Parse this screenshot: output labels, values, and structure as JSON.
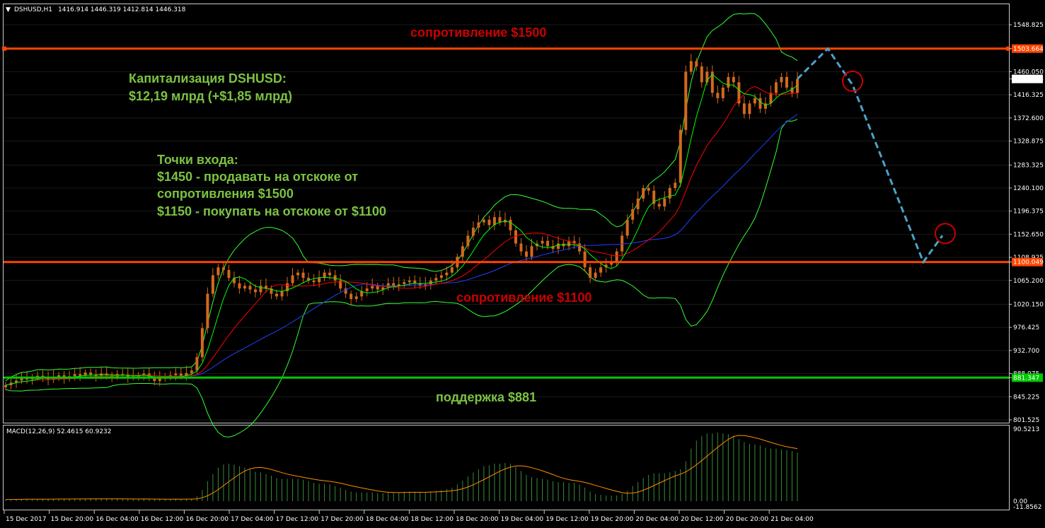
{
  "header": {
    "symbol": "DSHUSD,H1",
    "ohlc": "1416.914 1446.319 1412.814 1446.318"
  },
  "macd": {
    "label": "MACD(12,26,9) 52.4615 60.9232",
    "axis": [
      "90.5213",
      "0.00",
      "-11.8562"
    ]
  },
  "price_axis": [
    "1548.825",
    "1503.664",
    "1460.050",
    "1446.318",
    "1416.325",
    "1372.600",
    "1328.875",
    "1283.325",
    "1240.100",
    "1196.375",
    "1152.650",
    "1108.925",
    "1100.049",
    "1065.200",
    "1020.150",
    "976.425",
    "932.700",
    "888.975",
    "881.347",
    "845.225",
    "801.525"
  ],
  "time_axis": [
    "15 Dec 2017",
    "15 Dec 20:00",
    "16 Dec 04:00",
    "16 Dec 12:00",
    "16 Dec 20:00",
    "17 Dec 04:00",
    "17 Dec 12:00",
    "17 Dec 20:00",
    "18 Dec 04:00",
    "18 Dec 12:00",
    "18 Dec 20:00",
    "19 Dec 04:00",
    "19 Dec 12:00",
    "19 Dec 20:00",
    "20 Dec 04:00",
    "20 Dec 12:00",
    "20 Dec 20:00",
    "21 Dec 04:00"
  ],
  "annotations": {
    "resistance_top": "сопротивление $1500",
    "resistance_low": "сопротивление $1100",
    "support": "поддержка $881",
    "cap_line1": "Капитализация DSHUSD:",
    "cap_line2": "$12,19 млрд (+$1,85 млрд)",
    "entry_title": "Точки входа:",
    "entry_1": "$1450 - продавать на отскоке от",
    "entry_2": "сопротивления $1500",
    "entry_3": "$1150 - покупать на отскоке от $1100"
  },
  "colors": {
    "resistance": "#ff4500",
    "support": "#00c800",
    "candle": "#d2691e",
    "ma_fast": "#00ff00",
    "ma_mid": "#ff0000",
    "ma_slow": "#2040ff",
    "bollinger": "#33ff33",
    "forecast": "#4aa3c8",
    "ann_red": "#cc0000",
    "ann_green": "#7cc242"
  },
  "chart_data": {
    "type": "candlestick",
    "price_levels": {
      "resistance_top": 1503.664,
      "resistance_low": 1100.049,
      "support": 881.347,
      "current": 1446.318
    },
    "price_range": [
      801.525,
      1570
    ],
    "macd_range": [
      -11.8562,
      100
    ],
    "close_series": [
      867,
      872,
      876,
      880,
      878,
      882,
      885,
      881,
      877,
      883,
      886,
      880,
      884,
      888,
      885,
      891,
      887,
      884,
      889,
      886,
      883,
      888,
      887,
      882,
      884,
      886,
      889,
      881,
      875,
      880,
      884,
      886,
      889,
      884,
      890,
      895,
      920,
      975,
      1040,
      1075,
      1090,
      1085,
      1070,
      1060,
      1050,
      1055,
      1048,
      1043,
      1055,
      1050,
      1040,
      1035,
      1045,
      1060,
      1075,
      1080,
      1070,
      1065,
      1062,
      1070,
      1080,
      1075,
      1065,
      1050,
      1040,
      1030,
      1035,
      1045,
      1050,
      1055,
      1048,
      1052,
      1060,
      1055,
      1058,
      1062,
      1065,
      1060,
      1055,
      1058,
      1065,
      1070,
      1075,
      1080,
      1090,
      1110,
      1130,
      1150,
      1165,
      1175,
      1180,
      1170,
      1185,
      1175,
      1180,
      1160,
      1135,
      1120,
      1110,
      1130,
      1135,
      1140,
      1130,
      1125,
      1135,
      1130,
      1140,
      1135,
      1120,
      1090,
      1070,
      1080,
      1090,
      1095,
      1100,
      1120,
      1150,
      1180,
      1200,
      1220,
      1240,
      1235,
      1210,
      1205,
      1220,
      1240,
      1250,
      1350,
      1460,
      1480,
      1470,
      1440,
      1460,
      1420,
      1410,
      1430,
      1450,
      1440,
      1400,
      1380,
      1400,
      1410,
      1390,
      1400,
      1420,
      1440,
      1450,
      1430,
      1420,
      1446
    ],
    "macd_histogram": [
      2,
      2.2,
      2.5,
      2.6,
      2.5,
      2.6,
      2.8,
      2.7,
      2.4,
      2.6,
      2.9,
      2.6,
      2.8,
      3.0,
      2.9,
      3.1,
      2.9,
      2.7,
      2.9,
      2.8,
      2.6,
      2.8,
      2.7,
      2.5,
      2.6,
      2.7,
      2.8,
      2.4,
      2.2,
      2.3,
      2.5,
      2.6,
      2.7,
      2.5,
      2.8,
      3,
      6,
      14,
      25,
      34,
      42,
      46,
      47,
      46,
      44,
      42,
      40,
      37,
      36,
      34,
      32,
      29,
      28,
      28,
      28,
      28,
      27,
      25,
      23,
      22,
      22,
      21,
      19,
      17,
      14,
      12,
      11,
      11,
      11,
      11,
      10,
      10,
      11,
      11,
      11,
      12,
      12,
      12,
      11,
      11,
      12,
      13,
      14,
      15,
      17,
      21,
      26,
      31,
      36,
      40,
      44,
      45,
      47,
      47,
      48,
      47,
      43,
      38,
      33,
      30,
      29,
      28,
      27,
      25,
      24,
      24,
      23,
      23,
      21,
      17,
      12,
      9,
      8,
      7,
      7,
      7,
      9,
      13,
      19,
      24,
      29,
      33,
      35,
      35,
      35,
      36,
      38,
      40,
      50,
      66,
      76,
      82,
      85,
      85,
      86,
      85,
      84,
      82,
      78,
      74,
      72,
      71,
      70,
      67,
      66,
      66,
      65,
      64,
      63,
      61
    ],
    "forecast_path": [
      [
        1446,
        1503
      ],
      [
        1420,
        1430
      ],
      [
        1100,
        1150
      ]
    ]
  }
}
